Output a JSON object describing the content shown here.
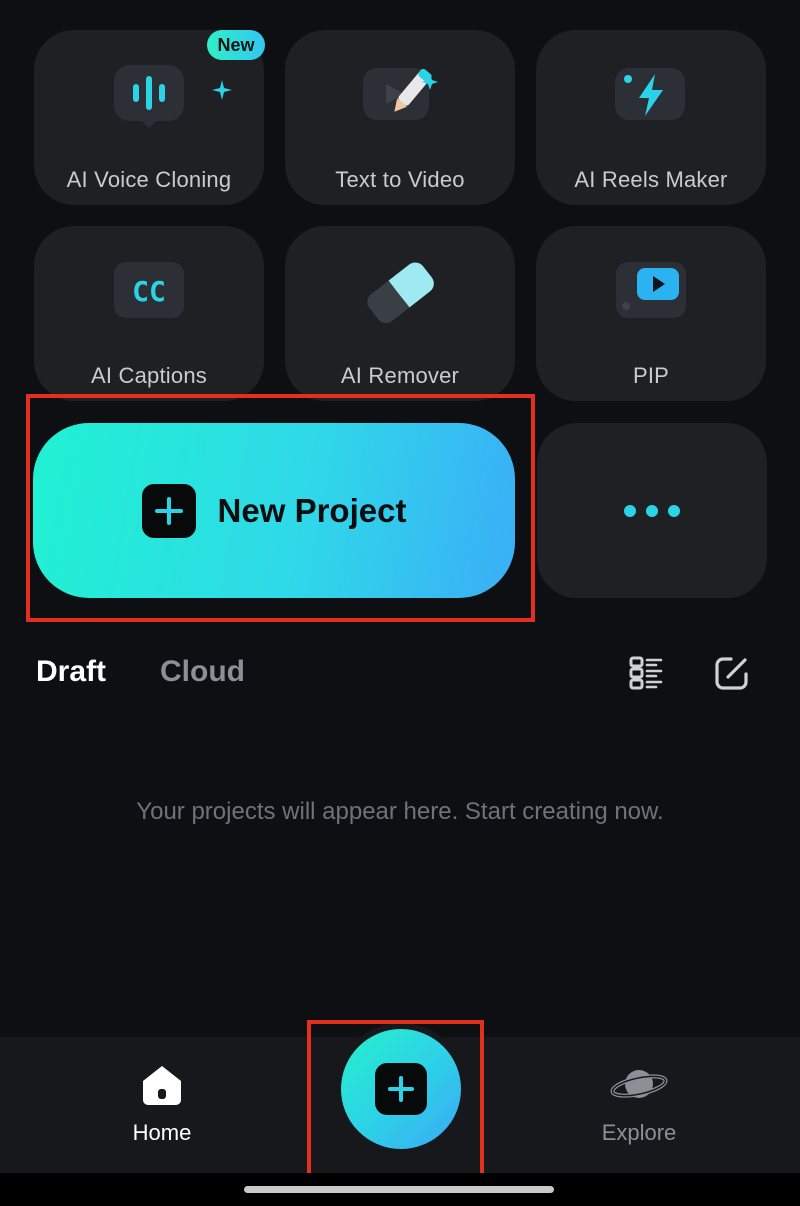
{
  "tools": [
    {
      "label": "AI Voice Cloning",
      "icon": "voice-wave-icon",
      "badge": "New"
    },
    {
      "label": "Text to Video",
      "icon": "text-to-video-icon"
    },
    {
      "label": "AI Reels Maker",
      "icon": "lightning-icon"
    },
    {
      "label": "AI Captions",
      "icon": "cc-icon",
      "icon_text": "CC"
    },
    {
      "label": "AI Remover",
      "icon": "eraser-icon"
    },
    {
      "label": "PIP",
      "icon": "picture-in-picture-icon"
    }
  ],
  "new_project": {
    "label": "New Project"
  },
  "tabs": {
    "draft": "Draft",
    "cloud": "Cloud"
  },
  "empty_state": "Your projects will appear here. Start creating now.",
  "nav": {
    "home": "Home",
    "explore": "Explore"
  },
  "colors": {
    "accent_start": "#20f2d2",
    "accent_end": "#3aaef7",
    "highlight": "#e2301f",
    "tile": "#1e2024"
  }
}
